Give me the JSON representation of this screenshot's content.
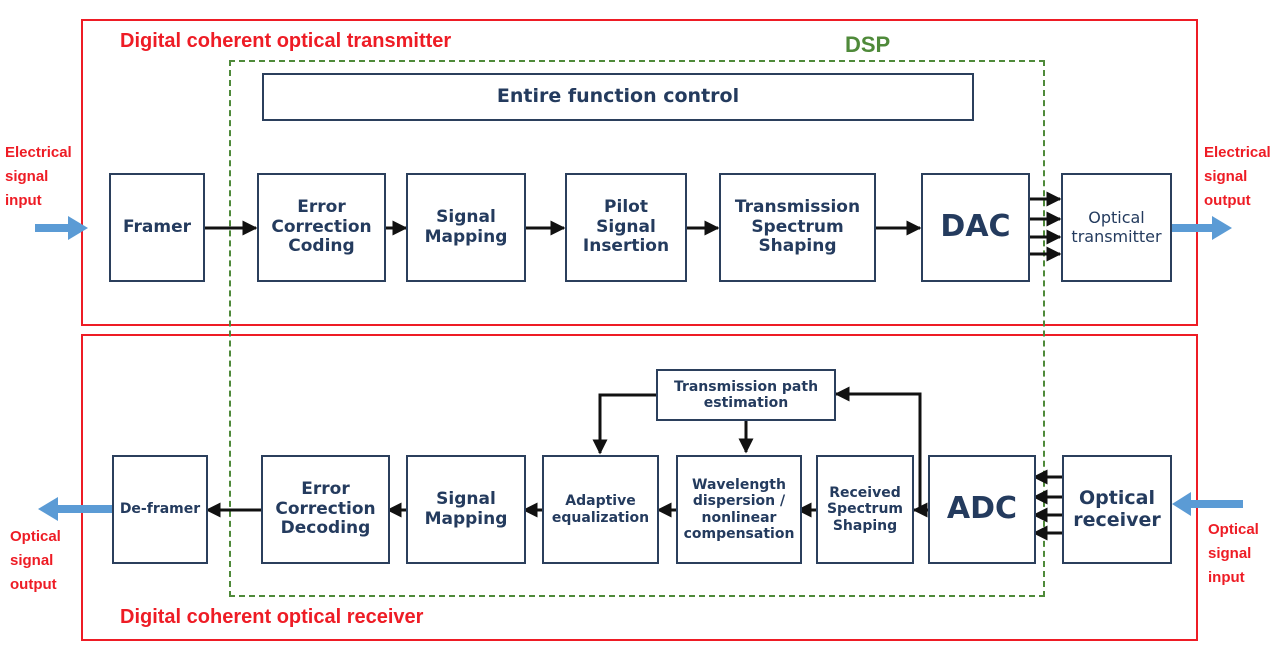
{
  "diagram": {
    "dsp_label": "DSP",
    "transmitter": {
      "title": "Digital coherent optical transmitter",
      "input_label": "Electrical\nsignal\ninput",
      "output_label": "Electrical\nsignal\noutput",
      "control_block": "Entire function control",
      "blocks": [
        {
          "id": "framer",
          "label": "Framer"
        },
        {
          "id": "ecc",
          "label": "Error\nCorrection\nCoding"
        },
        {
          "id": "mapping",
          "label": "Signal\nMapping"
        },
        {
          "id": "pilot",
          "label": "Pilot\nSignal\nInsertion"
        },
        {
          "id": "shaping",
          "label": "Transmission\nSpectrum\nShaping"
        },
        {
          "id": "dac",
          "label": "DAC"
        },
        {
          "id": "optx",
          "label": "Optical\ntransmitter"
        }
      ]
    },
    "receiver": {
      "title": "Digital coherent optical receiver",
      "input_label": "Optical\nsignal\ninput",
      "output_label": "Optical\nsignal\noutput",
      "estimation_block": "Transmission path\nestimation",
      "blocks": [
        {
          "id": "deframer",
          "label": "De-framer"
        },
        {
          "id": "ecd",
          "label": "Error\nCorrection\nDecoding"
        },
        {
          "id": "mapping",
          "label": "Signal\nMapping"
        },
        {
          "id": "equalization",
          "label": "Adaptive\nequalization"
        },
        {
          "id": "dispersion",
          "label": "Wavelength\ndispersion /\nnonlinear\ncompensation"
        },
        {
          "id": "rx_shaping",
          "label": "Received\nSpectrum\nShaping"
        },
        {
          "id": "adc",
          "label": "ADC"
        },
        {
          "id": "oprx",
          "label": "Optical\nreceiver"
        }
      ]
    },
    "colors": {
      "section_border": "#ee1c25",
      "dsp_border": "#4f8a3a",
      "block_border": "#2b3f5c",
      "block_text": "#243b5e",
      "signal_arrow": "#5b9bd5"
    }
  }
}
